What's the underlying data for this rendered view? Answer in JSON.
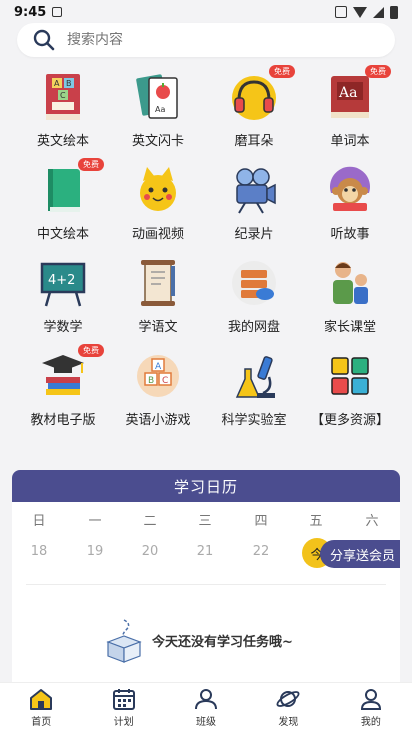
{
  "status": {
    "time": "9:45"
  },
  "search": {
    "placeholder": "搜索内容"
  },
  "grid": [
    {
      "label": "英文绘本",
      "icon": "abc-book-icon"
    },
    {
      "label": "英文闪卡",
      "icon": "flashcard-icon"
    },
    {
      "label": "磨耳朵",
      "icon": "headphones-icon",
      "badge": "免费"
    },
    {
      "label": "单词本",
      "icon": "dictionary-icon",
      "badge": "免费"
    },
    {
      "label": "中文绘本",
      "icon": "green-book-icon",
      "badge": "免费"
    },
    {
      "label": "动画视频",
      "icon": "cartoon-icon"
    },
    {
      "label": "纪录片",
      "icon": "camera-icon"
    },
    {
      "label": "听故事",
      "icon": "monkey-story-icon"
    },
    {
      "label": "学数学",
      "icon": "math-board-icon"
    },
    {
      "label": "学语文",
      "icon": "scroll-icon"
    },
    {
      "label": "我的网盘",
      "icon": "cloud-drive-icon"
    },
    {
      "label": "家长课堂",
      "icon": "parent-child-icon"
    },
    {
      "label": "教材电子版",
      "icon": "graduation-books-icon",
      "badge": "免费"
    },
    {
      "label": "英语小游戏",
      "icon": "abc-blocks-icon"
    },
    {
      "label": "科学实验室",
      "icon": "microscope-icon"
    },
    {
      "label": "【更多资源】",
      "icon": "more-grid-icon"
    }
  ],
  "calendar": {
    "title": "学习日历",
    "weekdays": [
      "日",
      "一",
      "二",
      "三",
      "四",
      "五",
      "六"
    ],
    "dates": [
      "18",
      "19",
      "20",
      "21",
      "22"
    ],
    "today_label": "今",
    "share_label": "分享送会员",
    "empty_text": "今天还没有学习任务哦~"
  },
  "tabs": [
    {
      "label": "首页",
      "icon": "home-icon",
      "active": true
    },
    {
      "label": "计划",
      "icon": "calendar-icon"
    },
    {
      "label": "班级",
      "icon": "class-icon"
    },
    {
      "label": "发现",
      "icon": "planet-icon"
    },
    {
      "label": "我的",
      "icon": "profile-icon"
    }
  ],
  "colors": {
    "accent": "#4b4d8f",
    "badge": "#e8433b",
    "today": "#f2c21b"
  }
}
